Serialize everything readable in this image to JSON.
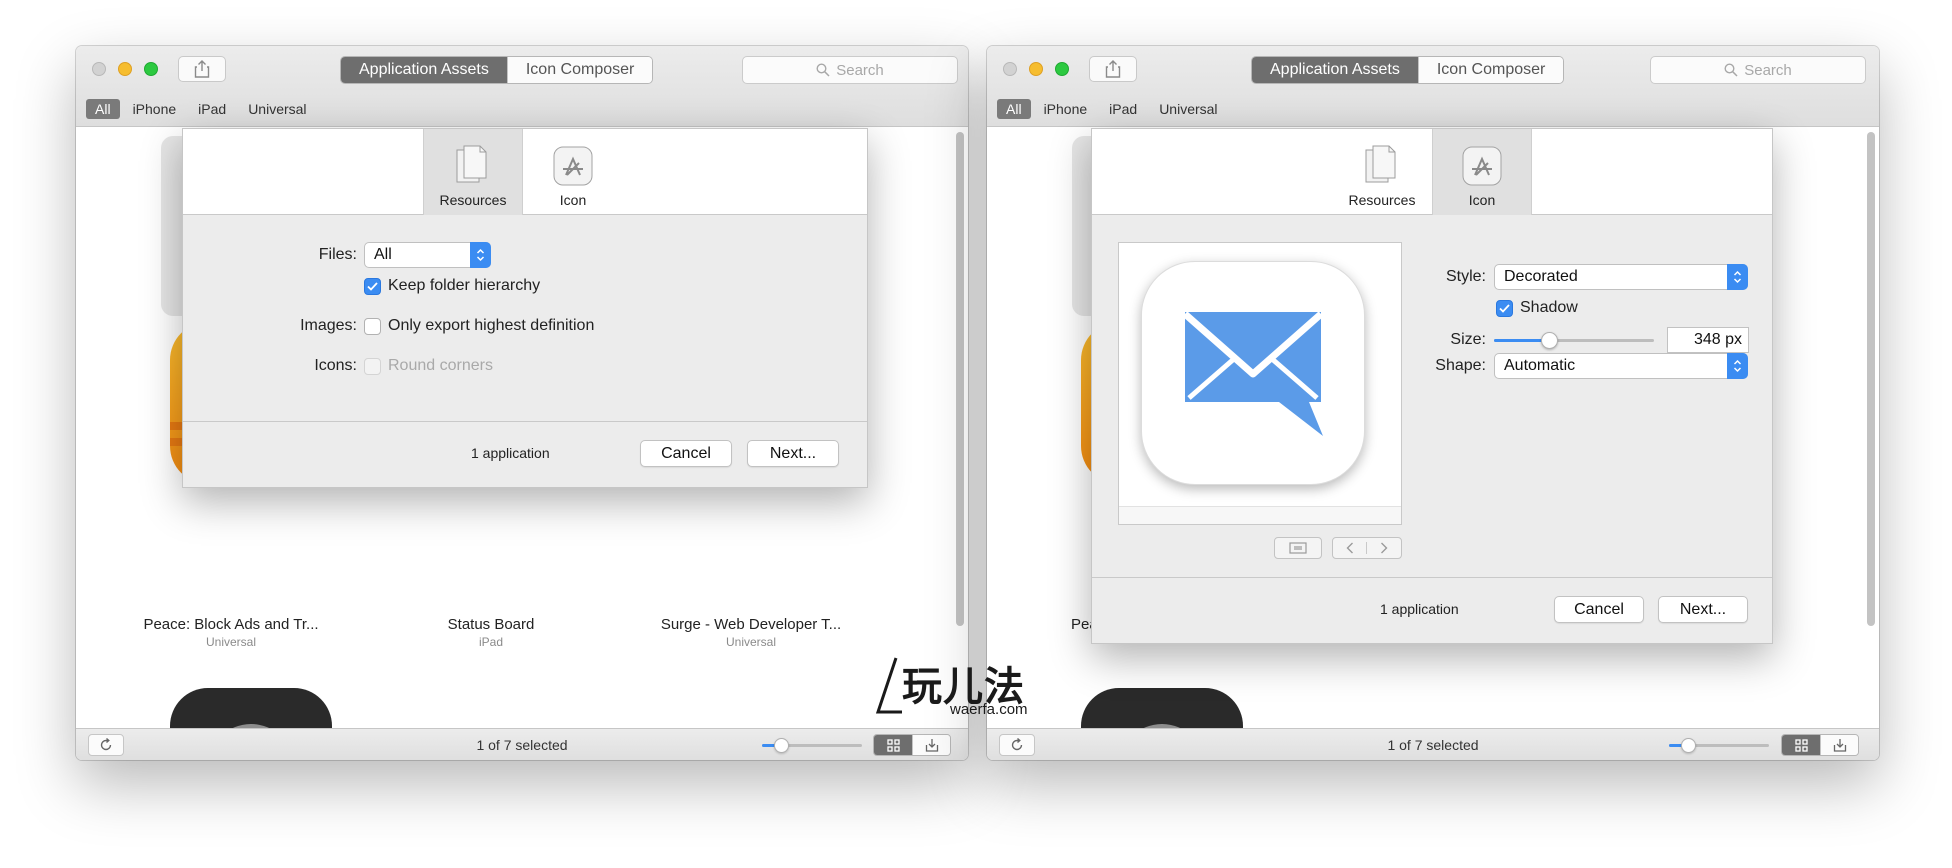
{
  "toolbar": {
    "tabs": [
      "Application Assets",
      "Icon Composer"
    ],
    "search_placeholder": "Search",
    "filters": [
      "All",
      "iPhone",
      "iPad",
      "Universal"
    ]
  },
  "bottom": {
    "status": "1 of 7 selected"
  },
  "apps": [
    {
      "name": "Peace: Block Ads and Tr...",
      "type": "Universal"
    },
    {
      "name": "Status Board",
      "type": "iPad"
    },
    {
      "name": "Surge - Web Developer T...",
      "type": "Universal"
    },
    {
      "name": "Pea"
    }
  ],
  "sheet": {
    "tabs": [
      "Resources",
      "Icon"
    ],
    "count": "1 application",
    "cancel": "Cancel",
    "next": "Next..."
  },
  "resources": {
    "files_label": "Files:",
    "files_value": "All",
    "keep_hierarchy": "Keep folder hierarchy",
    "images_label": "Images:",
    "highest_def": "Only export highest definition",
    "icons_label": "Icons:",
    "round_corners": "Round corners"
  },
  "icon_pane": {
    "style_label": "Style:",
    "style_value": "Decorated",
    "shadow": "Shadow",
    "shape_label": "Shape:",
    "shape_value": "Automatic",
    "size_label": "Size:",
    "size_value": "348 px"
  },
  "watermark": {
    "main": "玩儿法",
    "sub": "waerfa.com"
  },
  "colors": {
    "accent": "#3b8cf2",
    "selected_segment": "#6e6e6e",
    "mail_icon": "#5b9be8"
  },
  "icons": [
    "share-icon",
    "search-icon",
    "refresh-icon",
    "grid-view-icon",
    "export-icon",
    "resources-icon",
    "app-store-icon",
    "mail-icon"
  ]
}
